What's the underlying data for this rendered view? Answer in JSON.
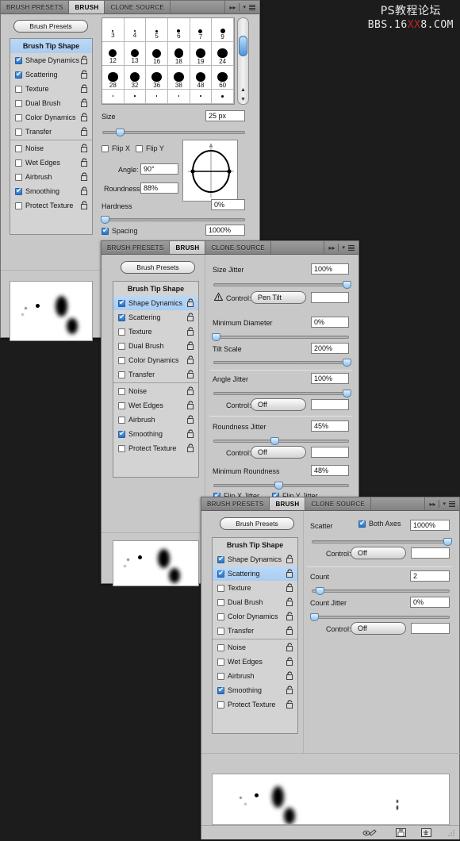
{
  "watermark": {
    "line1": "PS教程论坛",
    "line2_pre": "BBS.16",
    "line2_hot": "XX",
    "line2_post": "8.COM"
  },
  "tabs": {
    "presets": "BRUSH PRESETS",
    "brush": "BRUSH",
    "clone": "CLONE SOURCE"
  },
  "tab_tools": {
    "expand": "double-arrow-icon",
    "menu": "panel-menu-icon"
  },
  "presets_button": "Brush Presets",
  "option_list": [
    {
      "label": "Brush Tip Shape",
      "type": "header"
    },
    {
      "label": "Shape Dynamics",
      "checked": true
    },
    {
      "label": "Scattering",
      "checked": true
    },
    {
      "label": "Texture",
      "checked": false
    },
    {
      "label": "Dual Brush",
      "checked": false
    },
    {
      "label": "Color Dynamics",
      "checked": false
    },
    {
      "label": "Transfer",
      "checked": false
    },
    {
      "label": "Noise",
      "checked": false
    },
    {
      "label": "Wet Edges",
      "checked": false
    },
    {
      "label": "Airbrush",
      "checked": false
    },
    {
      "label": "Smoothing",
      "checked": true
    },
    {
      "label": "Protect Texture",
      "checked": false
    }
  ],
  "panel1": {
    "selected_option": "Brush Tip Shape",
    "brush_grid": {
      "rows": [
        [
          {
            "size": "3",
            "d": 2
          },
          {
            "size": "4",
            "d": 2.5
          },
          {
            "size": "5",
            "d": 3
          },
          {
            "size": "6",
            "d": 4
          },
          {
            "size": "7",
            "d": 5
          },
          {
            "size": "9",
            "d": 6
          }
        ],
        [
          {
            "size": "12",
            "d": 10
          },
          {
            "size": "13",
            "d": 10
          },
          {
            "size": "16",
            "d": 11
          },
          {
            "size": "18",
            "d": 11.5
          },
          {
            "size": "19",
            "d": 12
          },
          {
            "size": "24",
            "d": 12.5
          }
        ],
        [
          {
            "size": "28",
            "d": 12.5
          },
          {
            "size": "32",
            "d": 12.5
          },
          {
            "size": "36",
            "d": 12.5
          },
          {
            "size": "38",
            "d": 12.5
          },
          {
            "size": "48",
            "d": 12
          },
          {
            "size": "60",
            "d": 12.5
          }
        ],
        [
          {
            "size": "",
            "d": 1.5
          },
          {
            "size": "",
            "d": 1.5
          },
          {
            "size": "",
            "d": 1.5
          },
          {
            "size": "",
            "d": 1.5
          },
          {
            "size": "",
            "d": 2
          },
          {
            "size": "",
            "d": 3
          }
        ]
      ]
    },
    "size_label": "Size",
    "size_value": "25 px",
    "size_slider_pct": 12,
    "flip_x_label": "Flip X",
    "flip_x_checked": false,
    "flip_y_label": "Flip Y",
    "flip_y_checked": false,
    "angle_label": "Angle:",
    "angle_value": "90°",
    "roundness_label": "Roundness:",
    "roundness_value": "88%",
    "hardness_label": "Hardness",
    "hardness_value": "0%",
    "hardness_slider_pct": 0,
    "spacing_label": "Spacing",
    "spacing_checked": true,
    "spacing_value": "1000%",
    "spacing_slider_pct": 100
  },
  "panel2": {
    "selected_option": "Shape Dynamics",
    "size_jitter_label": "Size Jitter",
    "size_jitter_value": "100%",
    "size_jitter_pct": 100,
    "control1_label": "Control:",
    "control1_value": "Pen Tilt",
    "control1_extra": "",
    "control1_warning": "warning-triangle-icon",
    "min_diameter_label": "Minimum Diameter",
    "min_diameter_value": "0%",
    "min_diameter_pct": 0,
    "tilt_scale_label": "Tilt Scale",
    "tilt_scale_value": "200%",
    "tilt_scale_pct": 100,
    "angle_jitter_label": "Angle Jitter",
    "angle_jitter_value": "100%",
    "angle_jitter_pct": 100,
    "control2_label": "Control:",
    "control2_value": "Off",
    "control2_extra": "",
    "roundness_jitter_label": "Roundness Jitter",
    "roundness_jitter_value": "45%",
    "roundness_jitter_pct": 45,
    "control3_label": "Control:",
    "control3_value": "Off",
    "control3_extra": "",
    "min_roundness_label": "Minimum Roundness",
    "min_roundness_value": "48%",
    "min_roundness_pct": 48,
    "flip_x_jitter_label": "Flip X Jitter",
    "flip_x_jitter_checked": true,
    "flip_y_jitter_label": "Flip Y Jitter",
    "flip_y_jitter_checked": true
  },
  "panel3": {
    "selected_option": "Scattering",
    "scatter_label": "Scatter",
    "both_axes_label": "Both Axes",
    "both_axes_checked": true,
    "scatter_value": "1000%",
    "scatter_pct": 100,
    "control1_label": "Control:",
    "control1_value": "Off",
    "control1_extra": "",
    "count_label": "Count",
    "count_value": "2",
    "count_pct": 6,
    "count_jitter_label": "Count Jitter",
    "count_jitter_value": "0%",
    "count_jitter_pct": 0,
    "control2_label": "Control:",
    "control2_value": "Off",
    "control2_extra": "",
    "footer_icons": [
      "brush-preview-toggle-icon",
      "new-preset-icon",
      "delete-brush-icon",
      "resize-grip-icon"
    ]
  }
}
